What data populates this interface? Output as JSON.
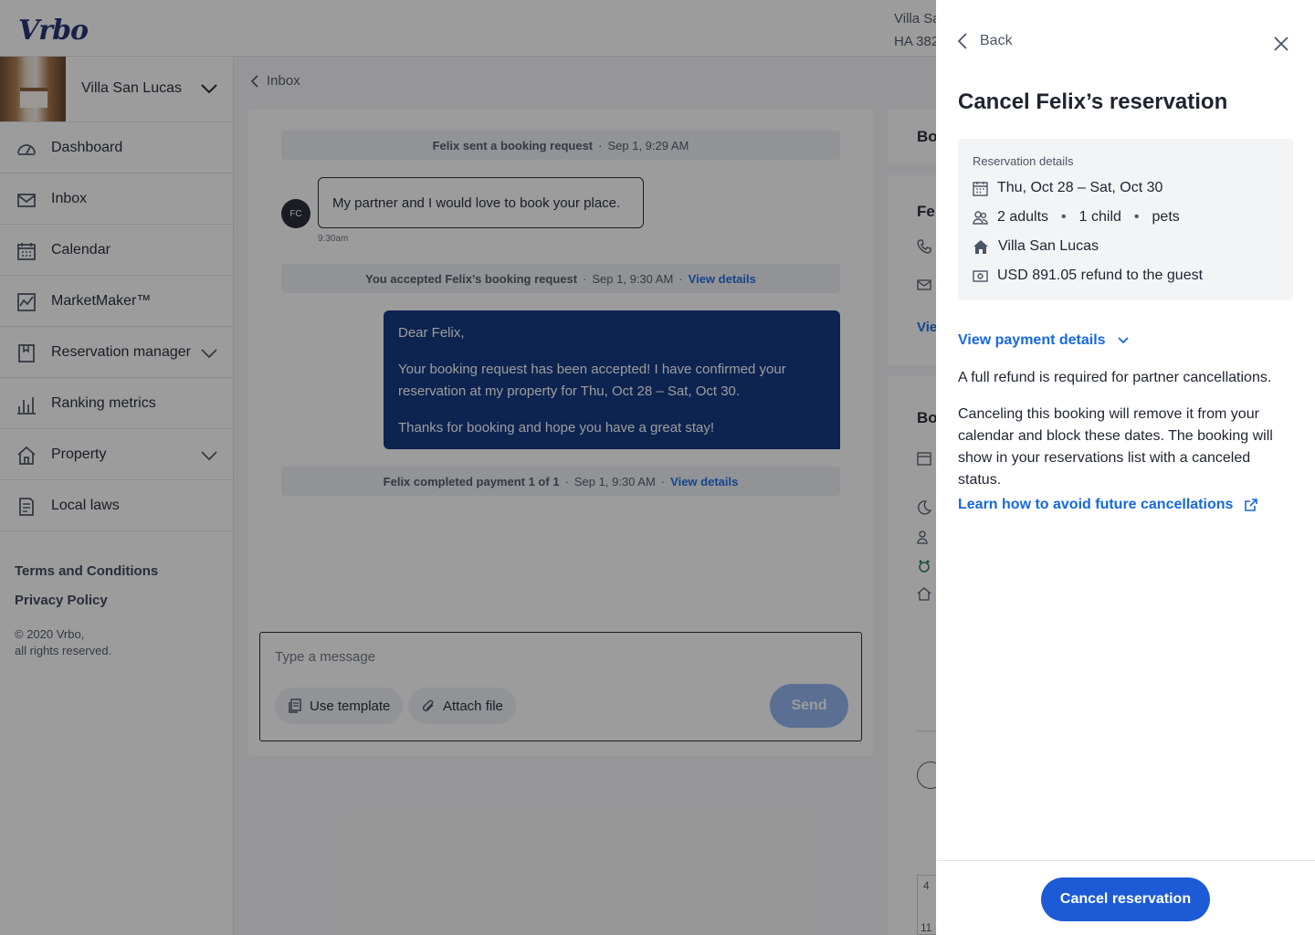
{
  "brand": {
    "logo_text": "Vrbo"
  },
  "header": {
    "property_line1": "Villa Sa",
    "property_line2": "HA 382"
  },
  "sidebar": {
    "property_name": "Villa San Lucas",
    "items": [
      {
        "label": "Dashboard",
        "icon": "dashboard-icon"
      },
      {
        "label": "Inbox",
        "icon": "mail-icon"
      },
      {
        "label": "Calendar",
        "icon": "calendar-icon"
      },
      {
        "label": "MarketMaker™",
        "icon": "chart-line-icon"
      },
      {
        "label": "Reservation manager",
        "icon": "bookmark-icon"
      },
      {
        "label": "Ranking metrics",
        "icon": "bar-chart-icon"
      },
      {
        "label": "Property",
        "icon": "home-icon"
      },
      {
        "label": "Local laws",
        "icon": "document-icon"
      }
    ],
    "footer_links": [
      "Terms and Conditions",
      "Privacy Policy"
    ],
    "copyright_line1": "© 2020 Vrbo,",
    "copyright_line2": "all rights reserved."
  },
  "inbox": {
    "back_label": "Inbox",
    "messages": {
      "booking_request": {
        "text": "Felix sent a booking request",
        "time": "Sep 1, 9:29 AM"
      },
      "guest_message": {
        "avatar": "FC",
        "text": "My partner and I would love to book your place.",
        "time": "9:30am"
      },
      "accepted": {
        "text": "You accepted Felix’s booking request",
        "time": "Sep 1, 9:30 AM",
        "link": "View details"
      },
      "host_reply": {
        "p1": "Dear Felix,",
        "p2": "Your booking request has been accepted! I have confirmed your reservation at my property for Thu, Oct 28 – Sat, Oct 30.",
        "p3": "Thanks for booking and hope you have a great stay!"
      },
      "payment": {
        "text": "Felix completed payment 1 of 1",
        "time": "Sep 1, 9:30 AM",
        "link": "View details"
      }
    },
    "composer": {
      "placeholder": "Type a message",
      "template_label": "Use template",
      "attach_label": "Attach file",
      "send_label": "Send"
    }
  },
  "right_panel": {
    "fragment1": "Bo",
    "fragment2": "Fel",
    "fragment3": "Vie",
    "fragment4": "Bo",
    "cal_cell1": "4",
    "cal_cell2": "11"
  },
  "drawer": {
    "back_label": "Back",
    "title": "Cancel Felix’s reservation",
    "details": {
      "heading": "Reservation details",
      "dates": "Thu, Oct 28 – Sat, Oct 30",
      "guests_adults": "2 adults",
      "guests_child": "1 child",
      "guests_pets": "pets",
      "property": "Villa San Lucas",
      "refund": "USD 891.05 refund to the guest"
    },
    "payment_link": "View payment details",
    "para1": "A full refund is required for partner cancellations.",
    "para2": "Canceling this booking will remove it from your calendar and block these dates. The booking will show in your reservations list with a canceled status.",
    "learn_link": "Learn how to avoid future cancellations",
    "cancel_button": "Cancel reservation"
  },
  "colors": {
    "brand_navy": "#1e2a6b",
    "link_blue": "#1668e3",
    "primary_button": "#1d5bd6",
    "host_bubble": "#0a2f7a"
  }
}
